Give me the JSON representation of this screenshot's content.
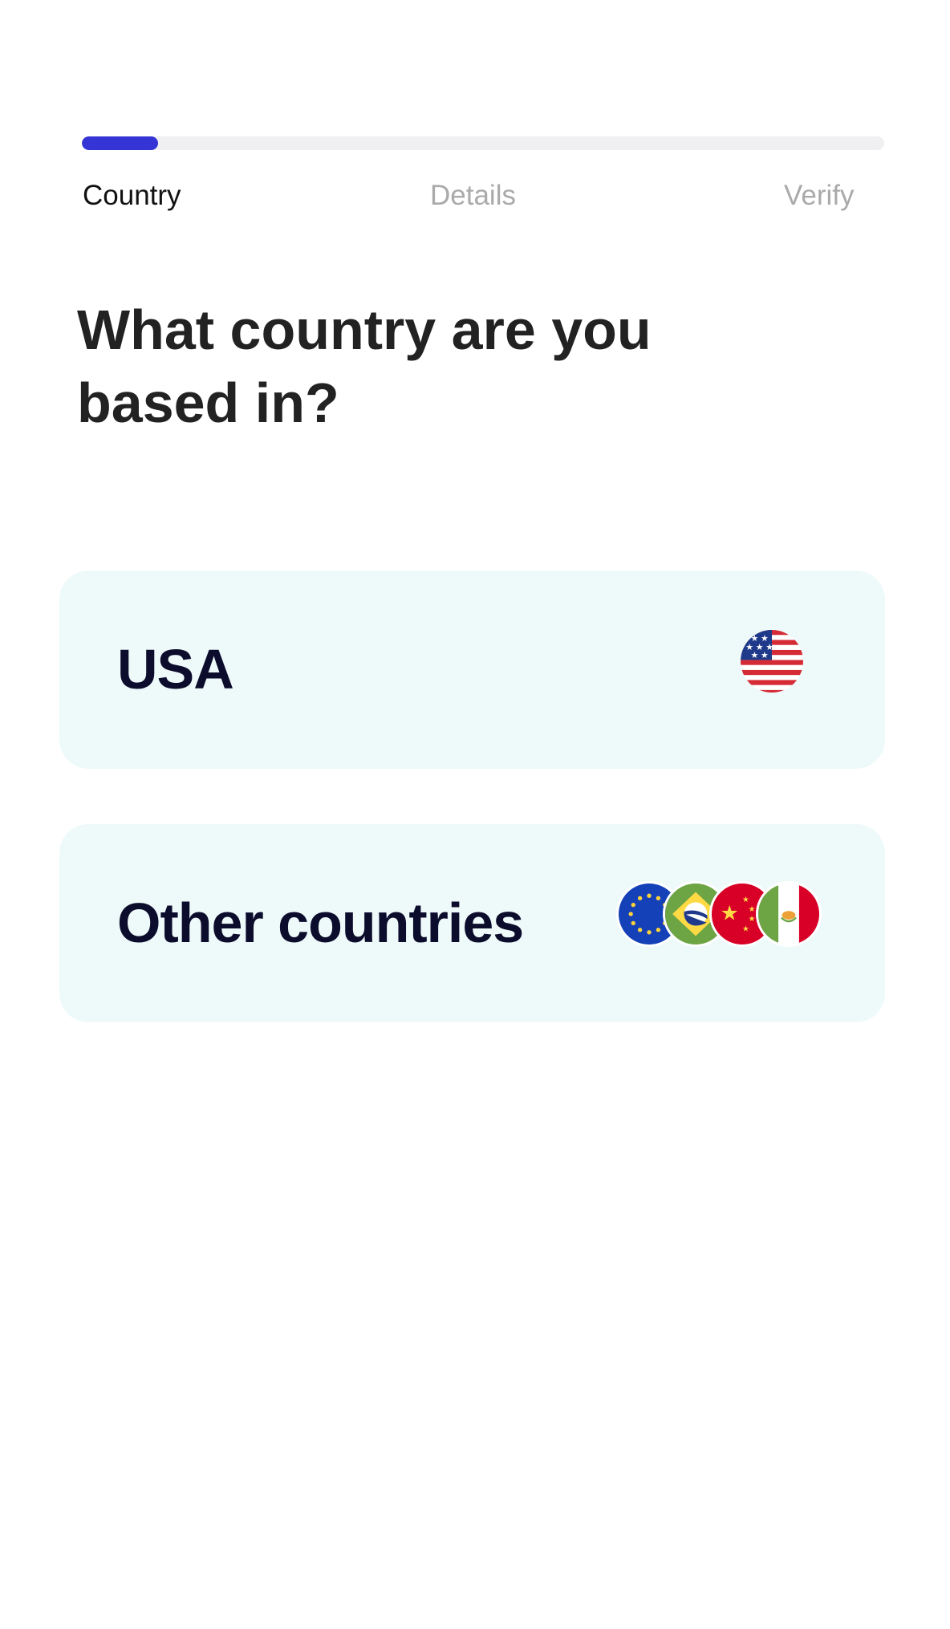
{
  "progress": {
    "fraction": 0.095,
    "color": "#3535d6",
    "track_color": "#f0f0f3"
  },
  "steps": [
    {
      "label": "Country",
      "active": true
    },
    {
      "label": "Details",
      "active": false
    },
    {
      "label": "Verify",
      "active": false
    }
  ],
  "question": "What country are you based in?",
  "options": [
    {
      "label": "USA",
      "flags": [
        "us-flag-icon"
      ]
    },
    {
      "label": "Other countries",
      "flags": [
        "eu-flag-icon",
        "brazil-flag-icon",
        "china-flag-icon",
        "mexico-flag-icon"
      ]
    }
  ],
  "colors": {
    "card_background": "#eefafa",
    "option_text": "#0c0c2c",
    "heading_text": "#222222"
  }
}
